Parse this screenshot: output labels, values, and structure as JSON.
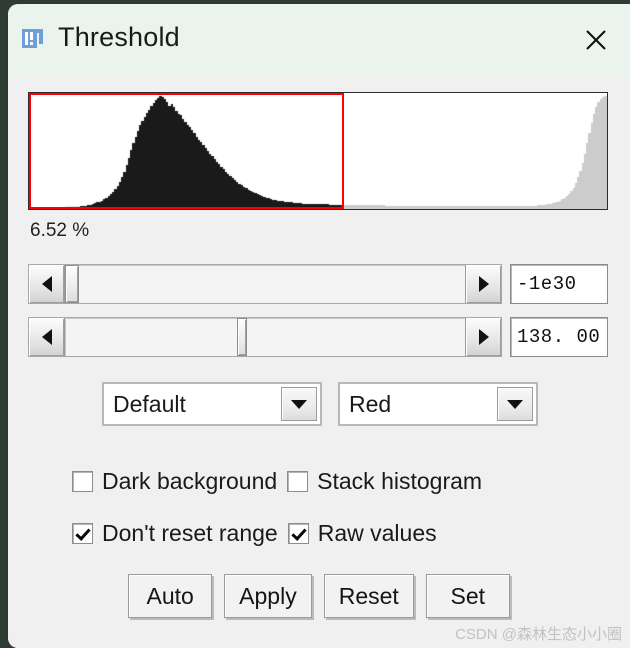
{
  "window": {
    "title": "Threshold",
    "icon": "imagej-icon",
    "close_icon": "close-icon"
  },
  "histogram": {
    "percent_label": "6.52 %",
    "selection_color": "#ff0000",
    "bar_color_dark": "#1a1a1a",
    "bar_color_light": "#cccccc",
    "background": "#ffffff",
    "selection_end_fraction": 0.543
  },
  "sliders": [
    {
      "name": "min-threshold-slider",
      "value": "-1e30",
      "thumb_fraction": 0.0,
      "thumb_width_fraction": 0.035,
      "left_arrow_icon": "triangle-left-icon",
      "right_arrow_icon": "triangle-right-icon"
    },
    {
      "name": "max-threshold-slider",
      "value": "138. 00",
      "thumb_fraction": 0.44,
      "thumb_width_fraction": 0.025,
      "left_arrow_icon": "triangle-left-icon",
      "right_arrow_icon": "triangle-right-icon"
    }
  ],
  "dropdowns": {
    "method": {
      "value": "Default",
      "arrow_icon": "chevron-down-icon"
    },
    "color": {
      "value": "Red",
      "arrow_icon": "chevron-down-icon"
    }
  },
  "checkboxes": {
    "dark_background": {
      "label": "Dark background",
      "checked": false
    },
    "stack_histogram": {
      "label": "Stack histogram",
      "checked": false
    },
    "dont_reset_range": {
      "label": "Don't reset range",
      "checked": true
    },
    "raw_values": {
      "label": "Raw values",
      "checked": true
    }
  },
  "buttons": {
    "auto": "Auto",
    "apply": "Apply",
    "reset": "Reset",
    "set": "Set"
  },
  "watermark": "CSDN @森林生态小小圈",
  "chart_data": {
    "type": "bar",
    "title": "Image intensity histogram",
    "xlabel": "",
    "ylabel": "",
    "grid": false,
    "legend": null,
    "bins": 256,
    "xlim": [
      0,
      255
    ],
    "ylim": [
      0,
      1
    ],
    "threshold_min_bin": 0,
    "threshold_max_bin": 138,
    "selected_fraction_percent": 6.52,
    "values": [
      0.01,
      0.01,
      0.01,
      0.01,
      0.01,
      0.01,
      0.01,
      0.01,
      0.01,
      0.01,
      0.01,
      0.01,
      0.012,
      0.012,
      0.012,
      0.012,
      0.014,
      0.014,
      0.016,
      0.016,
      0.018,
      0.02,
      0.022,
      0.024,
      0.026,
      0.03,
      0.034,
      0.038,
      0.044,
      0.05,
      0.058,
      0.066,
      0.074,
      0.086,
      0.098,
      0.112,
      0.13,
      0.15,
      0.175,
      0.205,
      0.24,
      0.28,
      0.33,
      0.39,
      0.45,
      0.52,
      0.58,
      0.64,
      0.69,
      0.74,
      0.78,
      0.81,
      0.85,
      0.88,
      0.915,
      0.94,
      0.965,
      0.985,
      1.0,
      0.995,
      0.975,
      0.945,
      0.915,
      0.93,
      0.9,
      0.87,
      0.84,
      0.83,
      0.8,
      0.77,
      0.745,
      0.73,
      0.7,
      0.67,
      0.64,
      0.615,
      0.59,
      0.565,
      0.54,
      0.515,
      0.49,
      0.465,
      0.44,
      0.415,
      0.395,
      0.37,
      0.35,
      0.33,
      0.31,
      0.29,
      0.27,
      0.255,
      0.24,
      0.225,
      0.21,
      0.195,
      0.185,
      0.172,
      0.16,
      0.15,
      0.14,
      0.132,
      0.122,
      0.115,
      0.108,
      0.1,
      0.094,
      0.088,
      0.082,
      0.078,
      0.074,
      0.07,
      0.068,
      0.064,
      0.062,
      0.06,
      0.058,
      0.056,
      0.054,
      0.052,
      0.05,
      0.048,
      0.047,
      0.046,
      0.046,
      0.045,
      0.044,
      0.043,
      0.043,
      0.042,
      0.041,
      0.041,
      0.04,
      0.039,
      0.039,
      0.038,
      0.038,
      0.038,
      0.037,
      0.037,
      0.036,
      0.036,
      0.035,
      0.035,
      0.035,
      0.034,
      0.034,
      0.034,
      0.033,
      0.033,
      0.033,
      0.032,
      0.032,
      0.032,
      0.031,
      0.031,
      0.031,
      0.031,
      0.03,
      0.03,
      0.03,
      0.03,
      0.03,
      0.029,
      0.029,
      0.029,
      0.029,
      0.028,
      0.028,
      0.028,
      0.028,
      0.028,
      0.028,
      0.027,
      0.027,
      0.027,
      0.027,
      0.027,
      0.027,
      0.026,
      0.026,
      0.026,
      0.026,
      0.026,
      0.026,
      0.026,
      0.025,
      0.025,
      0.025,
      0.025,
      0.025,
      0.025,
      0.025,
      0.025,
      0.024,
      0.024,
      0.024,
      0.024,
      0.024,
      0.024,
      0.024,
      0.024,
      0.024,
      0.024,
      0.024,
      0.024,
      0.023,
      0.023,
      0.023,
      0.023,
      0.023,
      0.023,
      0.023,
      0.024,
      0.024,
      0.024,
      0.024,
      0.025,
      0.025,
      0.026,
      0.026,
      0.027,
      0.028,
      0.029,
      0.03,
      0.031,
      0.033,
      0.035,
      0.037,
      0.04,
      0.043,
      0.047,
      0.052,
      0.058,
      0.065,
      0.074,
      0.085,
      0.098,
      0.115,
      0.135,
      0.16,
      0.19,
      0.23,
      0.28,
      0.34,
      0.41,
      0.49,
      0.58,
      0.67,
      0.76,
      0.84,
      0.9,
      0.945,
      0.975,
      0.99,
      1.0
    ]
  }
}
